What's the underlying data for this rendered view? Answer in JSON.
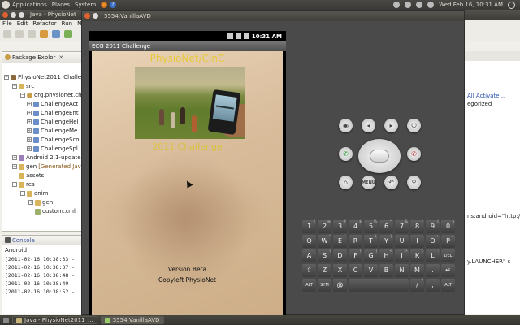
{
  "top_panel": {
    "menus": [
      "Applications",
      "Places",
      "System"
    ],
    "clock": "Wed Feb 16, 10:31 AM"
  },
  "eclipse": {
    "title": "Java - PhysioNet",
    "menu": [
      "File",
      "Edit",
      "Refactor",
      "Run",
      "Na"
    ],
    "package_explorer": {
      "tab": "Package Explor",
      "tree": [
        {
          "label": "PhysioNet2011_Challe",
          "icon": "project-icon"
        },
        {
          "label": "src",
          "icon": "folder-icon"
        },
        {
          "label": "org.physionet.ch",
          "icon": "package-icon"
        },
        {
          "label": "ChallengeAct",
          "icon": "java-file-icon"
        },
        {
          "label": "ChallengeEnt",
          "icon": "java-file-icon"
        },
        {
          "label": "ChallengeHel",
          "icon": "java-file-icon"
        },
        {
          "label": "ChallengeMe",
          "icon": "java-file-icon"
        },
        {
          "label": "ChallengeSco",
          "icon": "java-file-icon"
        },
        {
          "label": "ChallengeSpl",
          "icon": "java-file-icon"
        },
        {
          "label": "Android 2.1-update",
          "icon": "library-icon"
        },
        {
          "label": "gen",
          "suffix": "[Generated Jav",
          "icon": "folder-icon"
        },
        {
          "label": "assets",
          "icon": "folder-icon"
        },
        {
          "label": "res",
          "icon": "folder-icon"
        },
        {
          "label": "anim",
          "icon": "folder-icon"
        },
        {
          "label": "gen",
          "icon": "folder-icon"
        },
        {
          "label": "custom.xml",
          "icon": "xml-file-icon"
        }
      ]
    },
    "console": {
      "tab": "Console",
      "label": "Android",
      "lines": [
        "[2011-02-16 10:38:33 -",
        "[2011-02-16 10:38:37 -",
        "[2011-02-16 10:38:48 -",
        "[2011-02-16 10:38:49 -",
        "[2011-02-16 10:38:52 -"
      ]
    },
    "right_pane": {
      "all": "All",
      "activate": "Activate...",
      "egorized": "egorized",
      "xmlns": "ns:android=\"http://sc",
      "launcher": "y.LAUNCHER\" c"
    }
  },
  "emulator": {
    "title": "5554:VanillaAVD",
    "status_time": "10:31 AM",
    "app_title": "ECG 2011 Challenge",
    "heading": "PhysioNet/CinC",
    "challenge": "2011 Challenge",
    "version": "Version Beta",
    "copyleft": "Copyleft PhysioNet"
  },
  "keyboard": {
    "rows": [
      [
        {
          "k": "1",
          "s": "!"
        },
        {
          "k": "2",
          "s": "@"
        },
        {
          "k": "3",
          "s": "#"
        },
        {
          "k": "4",
          "s": "$"
        },
        {
          "k": "5",
          "s": "%"
        },
        {
          "k": "6",
          "s": "^"
        },
        {
          "k": "7",
          "s": "&"
        },
        {
          "k": "8",
          "s": "*"
        },
        {
          "k": "9",
          "s": "("
        },
        {
          "k": "0",
          "s": ")"
        }
      ],
      [
        {
          "k": "Q",
          "s": "~"
        },
        {
          "k": "W",
          "s": "\""
        },
        {
          "k": "E",
          "s": "´"
        },
        {
          "k": "R",
          "s": ""
        },
        {
          "k": "T",
          "s": "{"
        },
        {
          "k": "Y",
          "s": "}"
        },
        {
          "k": "U",
          "s": "-"
        },
        {
          "k": "I",
          "s": "-"
        },
        {
          "k": "O",
          "s": "+"
        },
        {
          "k": "P",
          "s": "="
        }
      ],
      [
        {
          "k": "A",
          "s": ""
        },
        {
          "k": "S",
          "s": "\\"
        },
        {
          "k": "D",
          "s": ""
        },
        {
          "k": "F",
          "s": "["
        },
        {
          "k": "G",
          "s": "]"
        },
        {
          "k": "H",
          "s": "<"
        },
        {
          "k": "J",
          "s": ">"
        },
        {
          "k": "K",
          "s": ";"
        },
        {
          "k": "L",
          "s": ":"
        },
        {
          "k": "DEL",
          "s": ""
        }
      ],
      [
        {
          "k": "⇧",
          "s": ""
        },
        {
          "k": "Z",
          "s": ""
        },
        {
          "k": "X",
          "s": ""
        },
        {
          "k": "C",
          "s": ""
        },
        {
          "k": "V",
          "s": ""
        },
        {
          "k": "B",
          "s": ""
        },
        {
          "k": "N",
          "s": ""
        },
        {
          "k": "M",
          "s": ""
        },
        {
          "k": ".",
          "s": ""
        },
        {
          "k": "↵",
          "s": ""
        }
      ],
      [
        {
          "k": "ALT",
          "s": ""
        },
        {
          "k": "SYM",
          "s": ""
        },
        {
          "k": "@",
          "s": ""
        },
        {
          "k": "",
          "s": ""
        },
        {
          "k": "/",
          "s": "?"
        },
        {
          "k": ",",
          "s": ""
        },
        {
          "k": "ALT",
          "s": ""
        }
      ]
    ]
  },
  "taskbar": {
    "items": [
      "Java - PhysioNet2011_...",
      "5554:VanillaAVD"
    ]
  },
  "colors": {
    "app_heading": "#e7c93a",
    "ubuntu_panel": "#3c3b37"
  }
}
